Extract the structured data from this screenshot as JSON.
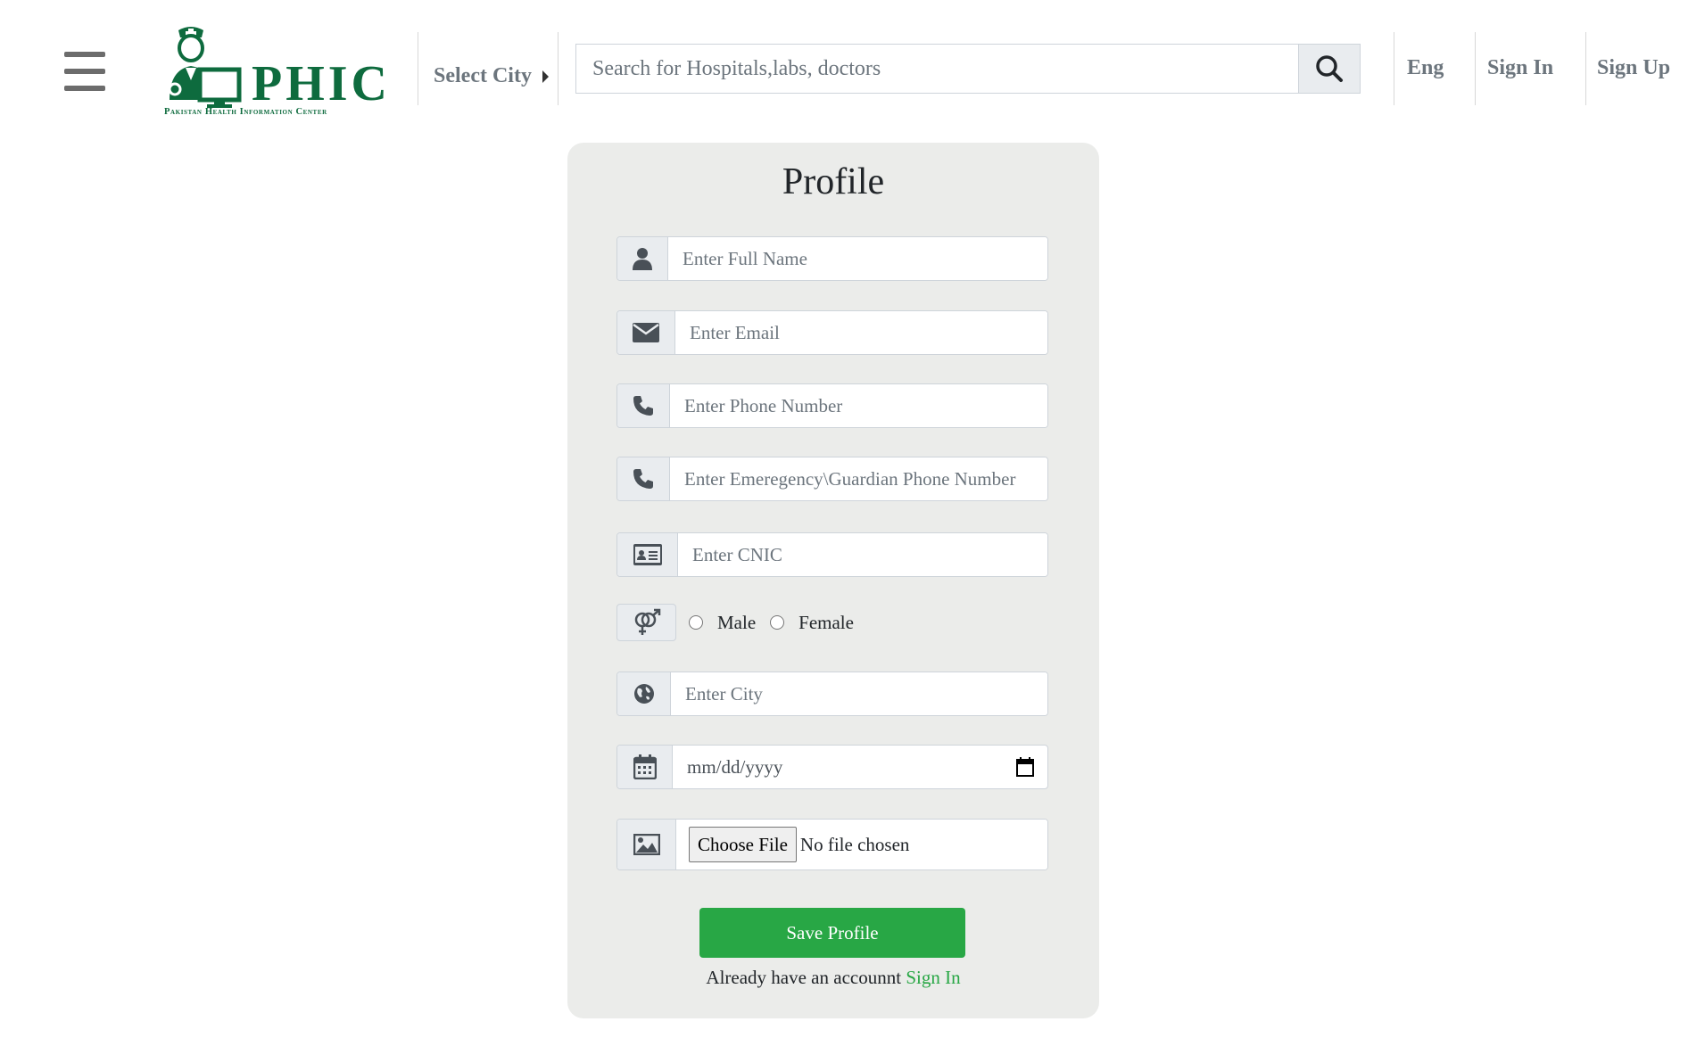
{
  "header": {
    "logo_text": "PHIC",
    "logo_subtitle": "Pakistan Health Information Center",
    "city_select_label": "Select City",
    "search_placeholder": "Search for Hospitals,labs, doctors",
    "language_label": "Eng",
    "sign_in_label": "Sign In",
    "sign_up_label": "Sign Up"
  },
  "profile": {
    "title": "Profile",
    "full_name_placeholder": "Enter Full Name",
    "email_placeholder": "Enter Email",
    "phone_placeholder": "Enter Phone Number",
    "emergency_phone_placeholder": "Enter Emeregency\\Guardian Phone Number",
    "cnic_placeholder": "Enter CNIC",
    "gender_options": [
      "Male",
      "Female"
    ],
    "city_placeholder": "Enter City",
    "date_placeholder": "mm/dd/yyyy",
    "choose_file_label": "Choose File",
    "no_file_text": "No file chosen",
    "save_button_label": "Save Profile",
    "already_text": "Already have an accounnt",
    "sign_in_link": "Sign In"
  },
  "colors": {
    "brand_green": "#0e6b3e",
    "button_green": "#28a745",
    "card_background": "#ebecea",
    "muted_text": "#6c757d"
  },
  "icons": [
    "menu-icon",
    "doctor-icon",
    "search-icon",
    "user-icon",
    "envelope-icon",
    "phone-icon",
    "id-card-icon",
    "gender-icon",
    "globe-icon",
    "calendar-icon",
    "image-icon"
  ]
}
